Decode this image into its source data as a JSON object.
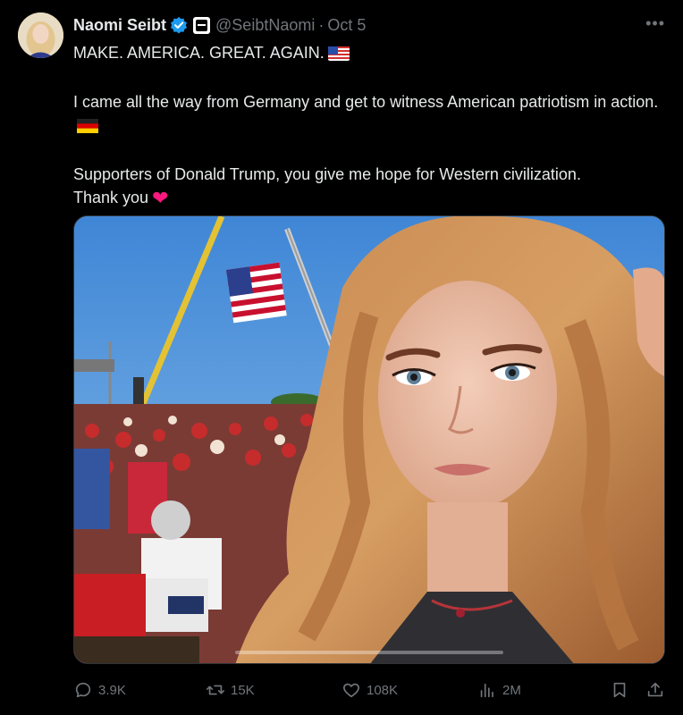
{
  "author": {
    "name": "Naomi Seibt",
    "handle": "@SeibtNaomi",
    "date": "Oct 5",
    "separator": "·"
  },
  "icons": {
    "verified": "verified-badge-icon",
    "affiliation": "affiliation-badge-icon",
    "more": "more-options-icon"
  },
  "post": {
    "line1": "MAKE. AMERICA. GREAT. AGAIN.",
    "line2": "I came all the way from Germany and get to witness American patriotism in action.",
    "line3": "Supporters of Donald Trump, you give me hope for Western civilization.",
    "line4": "Thank you"
  },
  "actions": {
    "replies": "3.9K",
    "reposts": "15K",
    "likes": "108K",
    "views": "2M"
  },
  "colors": {
    "background": "#000000",
    "text": "#e7e9ea",
    "muted": "#71767b",
    "verified": "#1d9bf0",
    "heart": "#f91880"
  }
}
